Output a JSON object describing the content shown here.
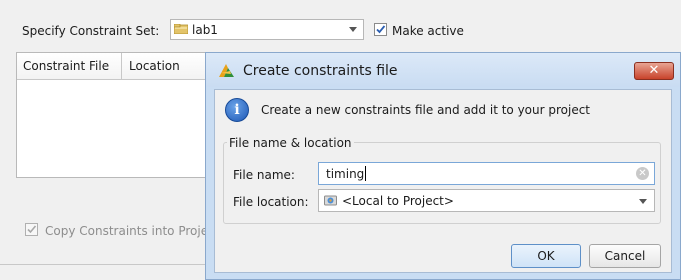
{
  "background": {
    "specify_label": "Specify Constraint Set:",
    "constraint_set_value": "lab1",
    "make_active_label": "Make active",
    "make_active_checked": true,
    "table_headers": [
      "Constraint File",
      "Location"
    ],
    "copy_label": "Copy Constraints into Proje",
    "copy_checked": true
  },
  "dialog": {
    "title": "Create constraints file",
    "close_label": "✕",
    "info_text": "Create a new constraints file and add it to your project",
    "group_title": "File name & location",
    "file_name_label": "File name:",
    "file_name_value": "timing",
    "file_location_label": "File location:",
    "file_location_value": "<Local to Project>",
    "ok_label": "OK",
    "cancel_label": "Cancel"
  },
  "colors": {
    "dialog_frame": "#c9ddf3",
    "close_button": "#c8432b",
    "info_icon": "#1d57b5"
  },
  "icons": [
    "folder-icon",
    "checkmark-icon",
    "app-logo-icon",
    "close-icon",
    "info-icon",
    "clear-icon",
    "location-icon",
    "dropdown-arrow-icon"
  ]
}
